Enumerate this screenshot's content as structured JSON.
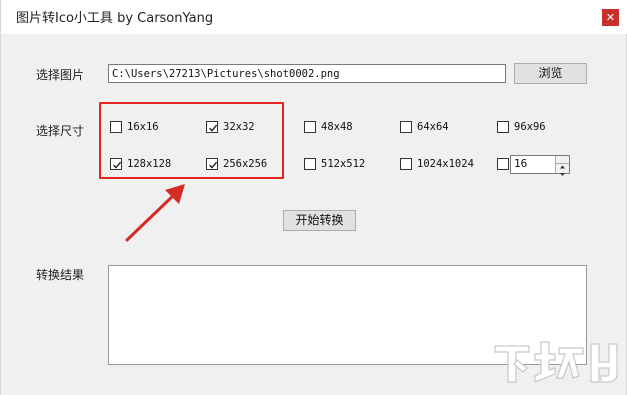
{
  "window": {
    "title": "图片转Ico小工具 by CarsonYang",
    "close_glyph": "✕"
  },
  "image_row": {
    "label": "选择图片",
    "path_value": "C:\\Users\\27213\\Pictures\\shot0002.png",
    "browse_label": "浏览"
  },
  "sizes": {
    "label": "选择尺寸",
    "options": [
      {
        "label": "16x16",
        "checked": false
      },
      {
        "label": "32x32",
        "checked": true
      },
      {
        "label": "48x48",
        "checked": false
      },
      {
        "label": "64x64",
        "checked": false
      },
      {
        "label": "96x96",
        "checked": false
      },
      {
        "label": "128x128",
        "checked": true
      },
      {
        "label": "256x256",
        "checked": true
      },
      {
        "label": "512x512",
        "checked": false
      },
      {
        "label": "1024x1024",
        "checked": false
      }
    ],
    "custom": {
      "checked": false,
      "value": "16"
    }
  },
  "convert_button": "开始转换",
  "result": {
    "label": "转换结果",
    "value": ""
  },
  "annotation": {
    "color": "#e52420"
  },
  "watermark": {
    "text": "下载吧"
  }
}
